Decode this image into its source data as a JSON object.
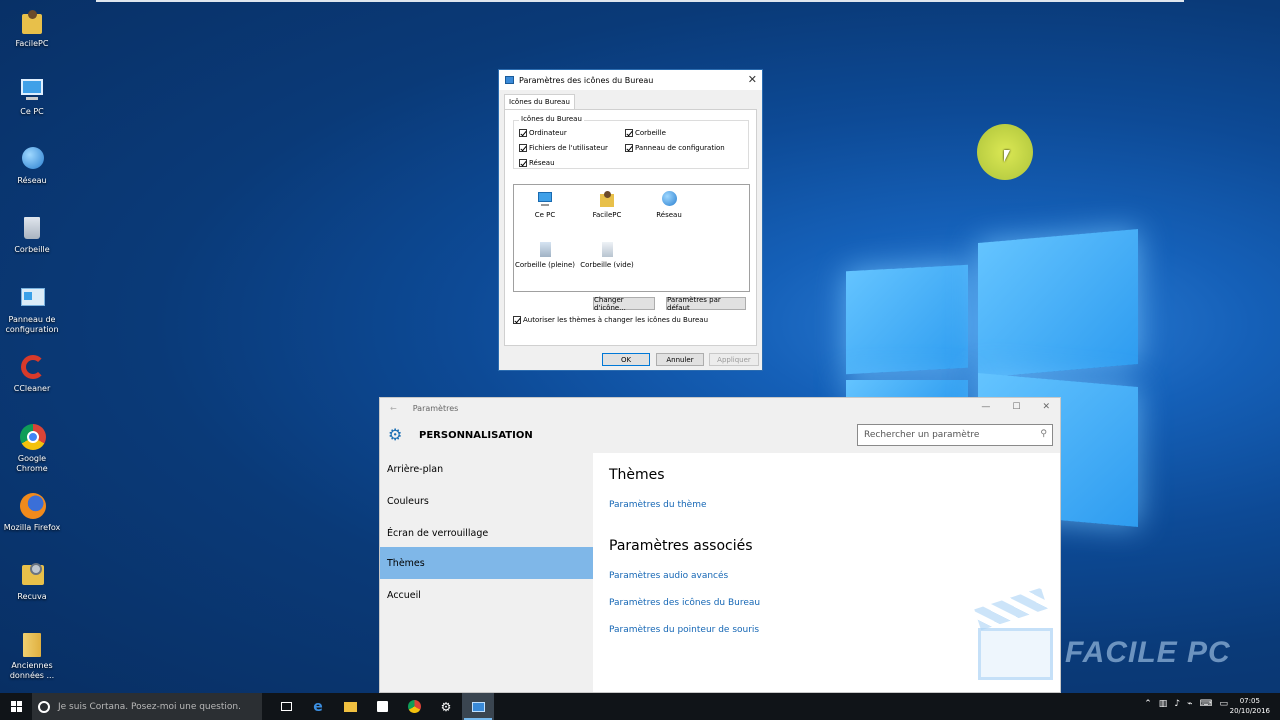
{
  "desktop": {
    "icons": [
      {
        "label": "FacilePC",
        "icon": "user-folder-icon"
      },
      {
        "label": "Ce PC",
        "icon": "computer-icon"
      },
      {
        "label": "Réseau",
        "icon": "network-icon"
      },
      {
        "label": "Corbeille",
        "icon": "recycle-bin-icon"
      },
      {
        "label": "Panneau de configuration",
        "icon": "control-panel-icon"
      },
      {
        "label": "CCleaner",
        "icon": "ccleaner-icon"
      },
      {
        "label": "Google Chrome",
        "icon": "chrome-icon"
      },
      {
        "label": "Mozilla Firefox",
        "icon": "firefox-icon"
      },
      {
        "label": "Recuva",
        "icon": "recuva-icon"
      },
      {
        "label": "Anciennes données ...",
        "icon": "folder-icon"
      }
    ]
  },
  "dialog": {
    "title": "Paramètres des icônes du Bureau",
    "close": "✕",
    "tab": "Icônes du Bureau",
    "group_title": "Icônes du Bureau",
    "checkboxes": [
      {
        "label": "Ordinateur",
        "checked": true
      },
      {
        "label": "Fichiers de l'utilisateur",
        "checked": true
      },
      {
        "label": "Réseau",
        "checked": true
      },
      {
        "label": "Corbeille",
        "checked": true
      },
      {
        "label": "Panneau de configuration",
        "checked": true
      }
    ],
    "preview_icons": [
      {
        "label": "Ce PC"
      },
      {
        "label": "FacilePC"
      },
      {
        "label": "Réseau"
      },
      {
        "label": "Corbeille (pleine)"
      },
      {
        "label": "Corbeille (vide)"
      }
    ],
    "change_icon": "Changer d'icône...",
    "defaults": "Paramètres par défaut",
    "allow_themes": "Autoriser les thèmes à changer les icônes du Bureau",
    "ok": "OK",
    "cancel": "Annuler",
    "apply": "Appliquer"
  },
  "settings": {
    "window_title": "Paramètres",
    "back": "←",
    "minimize": "—",
    "maximize": "☐",
    "close": "✕",
    "heading": "PERSONNALISATION",
    "search_placeholder": "Rechercher un paramètre",
    "nav": [
      {
        "label": "Arrière-plan",
        "active": false
      },
      {
        "label": "Couleurs",
        "active": false
      },
      {
        "label": "Écran de verrouillage",
        "active": false
      },
      {
        "label": "Thèmes",
        "active": true
      },
      {
        "label": "Accueil",
        "active": false
      }
    ],
    "section1_title": "Thèmes",
    "section1_link": "Paramètres du thème",
    "section2_title": "Paramètres associés",
    "section2_links": [
      "Paramètres audio avancés",
      "Paramètres des icônes du Bureau",
      "Paramètres du pointeur de souris"
    ]
  },
  "watermark": {
    "text": "FACILE PC"
  },
  "taskbar": {
    "cortana": "Je suis Cortana. Posez-moi une question.",
    "apps": [
      "task-view-icon",
      "edge-icon",
      "file-explorer-icon",
      "store-icon",
      "chrome-icon",
      "settings-icon",
      "desktop-icons-app-icon"
    ],
    "time": "07:05",
    "date": "20/10/2016"
  },
  "colors": {
    "accent": "#0078d7",
    "link": "#1667b5",
    "nav_active": "#7fb7e8"
  }
}
